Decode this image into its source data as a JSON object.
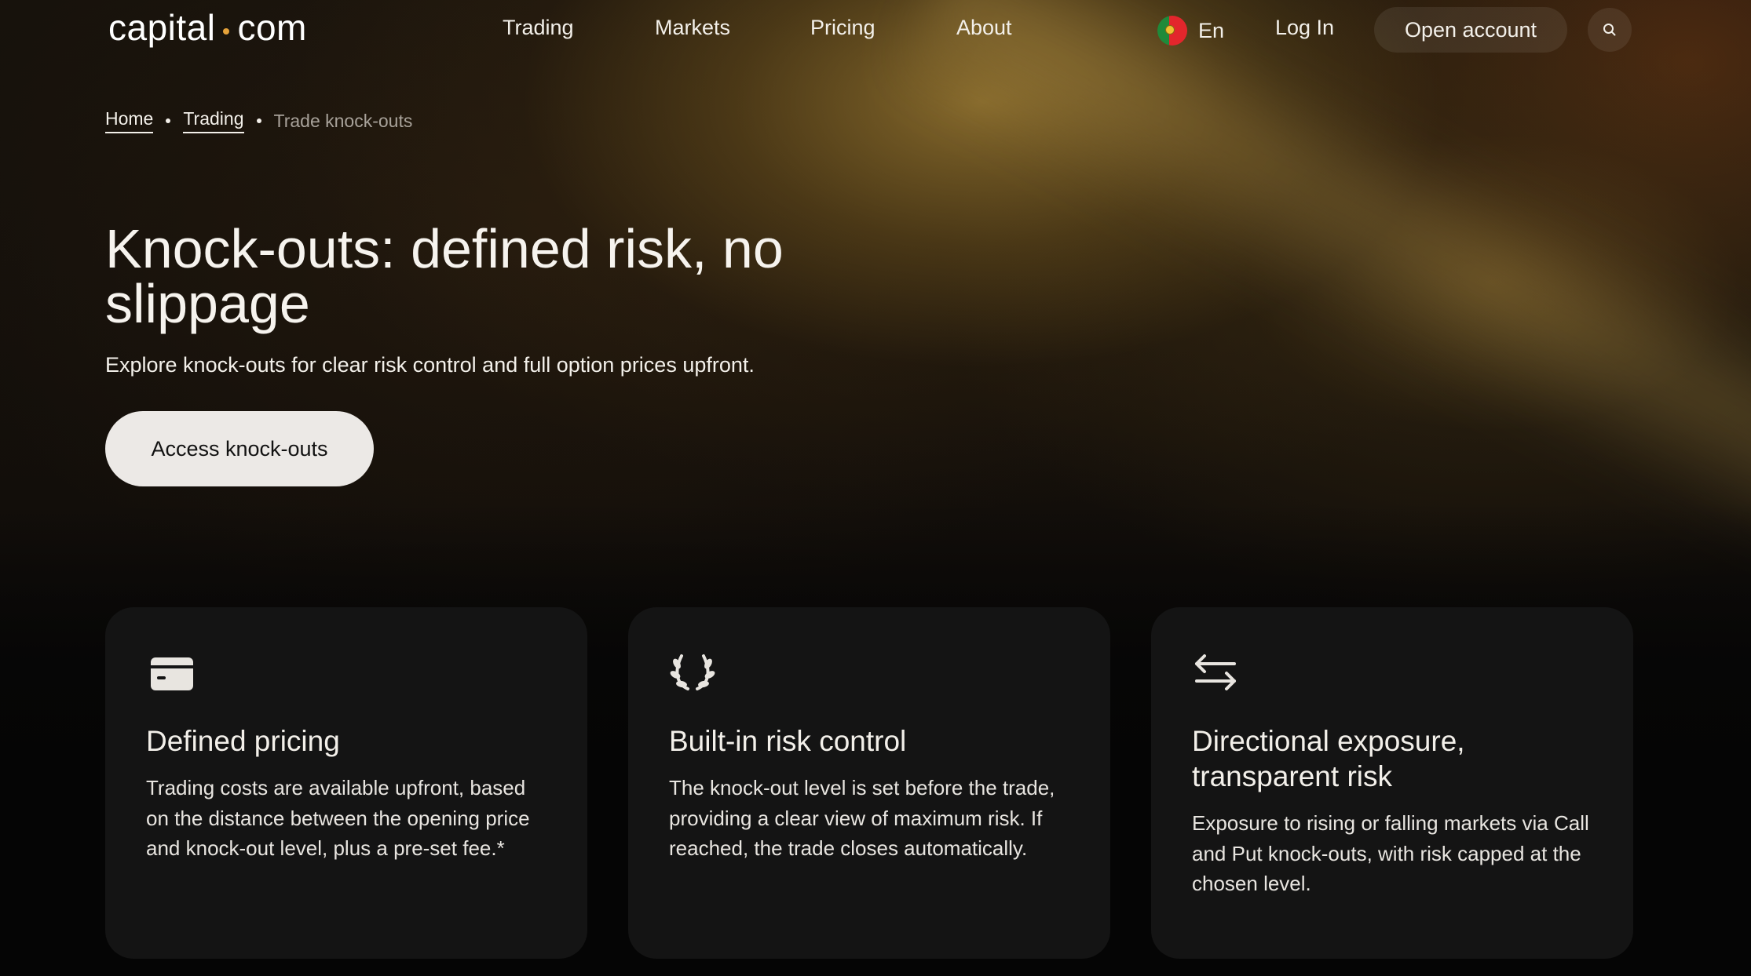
{
  "header": {
    "logo_left": "capital",
    "logo_right": "com",
    "nav": [
      "Trading",
      "Markets",
      "Pricing",
      "About"
    ],
    "language": "En",
    "login_label": "Log In",
    "open_account_label": "Open account",
    "search_icon": "search-icon",
    "flag_icon": "portugal-flag-icon"
  },
  "breadcrumb": {
    "items": [
      "Home",
      "Trading"
    ],
    "current": "Trade knock-outs"
  },
  "hero": {
    "title": "Knock-outs: defined risk, no slippage",
    "subtitle": "Explore knock-outs for clear risk control and full option prices upfront.",
    "cta_label": "Access knock-outs"
  },
  "cards": [
    {
      "icon": "card-icon",
      "title": "Defined pricing",
      "text": "Trading costs are available upfront, based on the distance between the opening price and knock-out level, plus a pre-set fee.*"
    },
    {
      "icon": "laurel-icon",
      "title": "Built-in risk control",
      "text": "The knock-out level is set before the trade, providing a clear view of maximum risk. If reached, the trade closes automatically."
    },
    {
      "icon": "swap-arrows-icon",
      "title": "Directional exposure, transparent risk",
      "text": "Exposure to rising or falling markets via Call and Put knock-outs, with risk capped at the chosen level."
    }
  ],
  "colors": {
    "accent_dot": "#e5a23a",
    "card_background": "#141414",
    "cta_background": "#ece9e6"
  }
}
